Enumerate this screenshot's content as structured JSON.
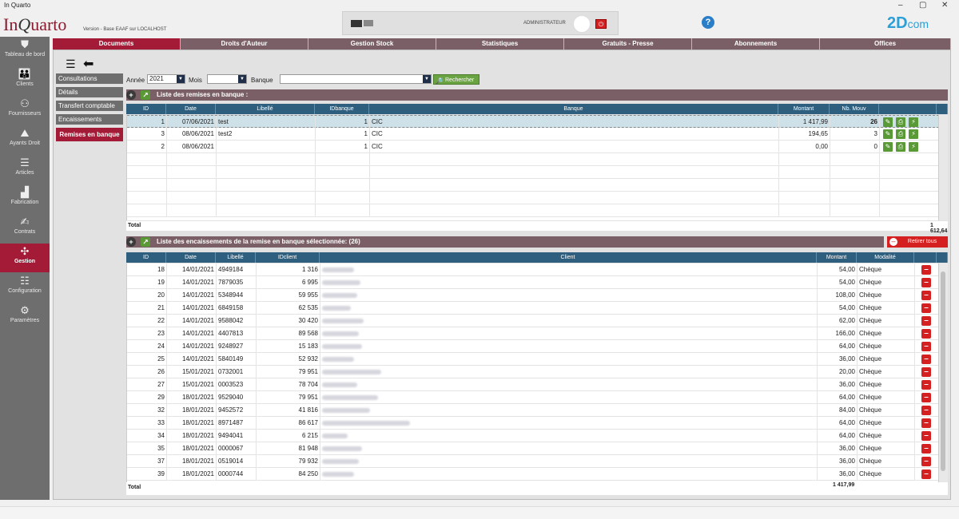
{
  "window": {
    "title": "In Quarto",
    "minimize": "–",
    "maximize": "▢",
    "close": "✕"
  },
  "header": {
    "logo_a": "In",
    "logo_b": "Q",
    "logo_c": "uarto",
    "version": "Version - Base EAAF sur LOCALHOST",
    "user": "ADMINISTRATEUR",
    "help": "?",
    "brand_a": "2D",
    "brand_b": "com"
  },
  "sidebar": {
    "items": [
      {
        "label": "Tableau de bord",
        "icon": "shield-icon",
        "glyph": "⛊"
      },
      {
        "label": "Clients",
        "icon": "clients-icon",
        "glyph": "👪"
      },
      {
        "label": "Fournisseurs",
        "icon": "suppliers-icon",
        "glyph": "⚇"
      },
      {
        "label": "Ayants Droit",
        "icon": "rights-holder-icon",
        "glyph": "⛰"
      },
      {
        "label": "Articles",
        "icon": "articles-icon",
        "glyph": "☰"
      },
      {
        "label": "Fabrication",
        "icon": "factory-icon",
        "glyph": "▟"
      },
      {
        "label": "Contrats",
        "icon": "contracts-icon",
        "glyph": "✍"
      },
      {
        "label": "Gestion",
        "icon": "network-icon",
        "glyph": "✣"
      },
      {
        "label": "Configuration",
        "icon": "sliders-icon",
        "glyph": "☷"
      },
      {
        "label": "Paramètres",
        "icon": "gears-icon",
        "glyph": "⚙"
      }
    ]
  },
  "tabs": [
    "Documents",
    "Droits d'Auteur",
    "Gestion Stock",
    "Statistiques",
    "Gratuits - Presse",
    "Abonnements",
    "Offices"
  ],
  "submenu": [
    "Consultations",
    "Détails",
    "Transfert comptable",
    "Encaissements",
    "Remises en banque"
  ],
  "filters": {
    "annee_label": "Année",
    "annee_value": "2021",
    "mois_label": "Mois",
    "mois_value": "",
    "banque_label": "Banque",
    "banque_value": "",
    "search": "Rechercher"
  },
  "remises": {
    "title": "Liste des remises en banque :",
    "columns": [
      "ID",
      "Date",
      "Libellé",
      "IDbanque",
      "Banque",
      "Montant",
      "Nb. Mouv"
    ],
    "rows": [
      {
        "id": "1",
        "date": "07/06/2021",
        "libelle": "test",
        "idbanque": "1",
        "banque": "CIC",
        "montant": "1 417,99",
        "nb": "26"
      },
      {
        "id": "3",
        "date": "08/06/2021",
        "libelle": "test2",
        "idbanque": "1",
        "banque": "CIC",
        "montant": "194,65",
        "nb": "3"
      },
      {
        "id": "2",
        "date": "08/06/2021",
        "libelle": "",
        "idbanque": "1",
        "banque": "CIC",
        "montant": "0,00",
        "nb": "0"
      }
    ],
    "total_label": "Total",
    "total_value": "1 612,64"
  },
  "encaissements": {
    "title": "Liste des encaissements de la remise en banque sélectionnée: (26)",
    "retirer": "Retirer tous",
    "columns": [
      "ID",
      "Date",
      "Libellé",
      "IDclient",
      "Client",
      "Montant",
      "Modalité"
    ],
    "rows": [
      {
        "id": "18",
        "date": "14/01/2021",
        "libelle": "4949184",
        "idclient": "1 316",
        "montant": "54,00",
        "modalite": "Chèque"
      },
      {
        "id": "19",
        "date": "14/01/2021",
        "libelle": "7879035",
        "idclient": "6 995",
        "montant": "54,00",
        "modalite": "Chèque"
      },
      {
        "id": "20",
        "date": "14/01/2021",
        "libelle": "5348944",
        "idclient": "59 955",
        "montant": "108,00",
        "modalite": "Chèque"
      },
      {
        "id": "21",
        "date": "14/01/2021",
        "libelle": "6849158",
        "idclient": "62 535",
        "montant": "54,00",
        "modalite": "Chèque"
      },
      {
        "id": "22",
        "date": "14/01/2021",
        "libelle": "9588042",
        "idclient": "30 420",
        "montant": "62,00",
        "modalite": "Chèque"
      },
      {
        "id": "23",
        "date": "14/01/2021",
        "libelle": "4407813",
        "idclient": "89 568",
        "montant": "166,00",
        "modalite": "Chèque"
      },
      {
        "id": "24",
        "date": "14/01/2021",
        "libelle": "9248927",
        "idclient": "15 183",
        "montant": "64,00",
        "modalite": "Chèque"
      },
      {
        "id": "25",
        "date": "14/01/2021",
        "libelle": "5840149",
        "idclient": "52 932",
        "montant": "36,00",
        "modalite": "Chèque"
      },
      {
        "id": "26",
        "date": "15/01/2021",
        "libelle": "0732001",
        "idclient": "79 951",
        "montant": "20,00",
        "modalite": "Chèque"
      },
      {
        "id": "27",
        "date": "15/01/2021",
        "libelle": "0003523",
        "idclient": "78 704",
        "montant": "36,00",
        "modalite": "Chèque"
      },
      {
        "id": "29",
        "date": "18/01/2021",
        "libelle": "9529040",
        "idclient": "79 951",
        "montant": "64,00",
        "modalite": "Chèque"
      },
      {
        "id": "32",
        "date": "18/01/2021",
        "libelle": "9452572",
        "idclient": "41 816",
        "montant": "84,00",
        "modalite": "Chèque"
      },
      {
        "id": "33",
        "date": "18/01/2021",
        "libelle": "8971487",
        "idclient": "86 617",
        "montant": "64,00",
        "modalite": "Chèque"
      },
      {
        "id": "34",
        "date": "18/01/2021",
        "libelle": "9494041",
        "idclient": "6 215",
        "montant": "64,00",
        "modalite": "Chèque"
      },
      {
        "id": "35",
        "date": "18/01/2021",
        "libelle": "0000067",
        "idclient": "81 948",
        "montant": "36,00",
        "modalite": "Chèque"
      },
      {
        "id": "37",
        "date": "18/01/2021",
        "libelle": "0519014",
        "idclient": "79 932",
        "montant": "36,00",
        "modalite": "Chèque"
      },
      {
        "id": "39",
        "date": "18/01/2021",
        "libelle": "0000744",
        "idclient": "84 250",
        "montant": "36,00",
        "modalite": "Chèque"
      }
    ],
    "total_label": "Total",
    "total_value": "1 417,99"
  },
  "colors": {
    "accent": "#a31b36",
    "header_row": "#2f5f7e",
    "section": "#7a5f66",
    "green": "#5a9a36",
    "danger": "#d42020"
  }
}
